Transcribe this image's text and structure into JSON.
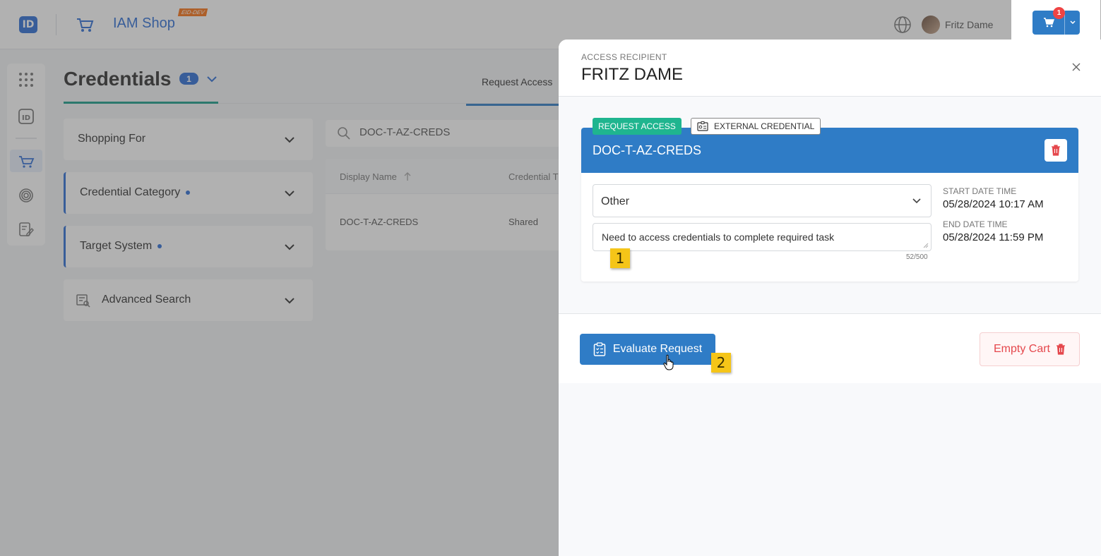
{
  "app": {
    "logo": "ID",
    "title": "IAM Shop",
    "env_badge": "EID-DEV",
    "user_name": "Fritz Dame",
    "cart_count": "1"
  },
  "page": {
    "title": "Credentials",
    "count": "1",
    "tab_request_access": "Request Access"
  },
  "filters": {
    "shopping_for": "Shopping For",
    "credential_category": "Credential Category",
    "target_system": "Target System",
    "advanced_search": "Advanced Search"
  },
  "search": {
    "value": "DOC-T-AZ-CREDS"
  },
  "grid": {
    "headers": [
      "Display Name",
      "Credential T"
    ],
    "rows": [
      {
        "display_name": "DOC-T-AZ-CREDS",
        "type": "Shared"
      }
    ]
  },
  "drawer": {
    "recipient_label": "ACCESS RECIPIENT",
    "recipient_name": "FRITZ DAME",
    "item": {
      "tag_request": "REQUEST ACCESS",
      "tag_type": "EXTERNAL CREDENTIAL",
      "name": "DOC-T-AZ-CREDS",
      "reason": "Other",
      "justification": "Need to access credentials to complete required task",
      "char_count": "52/500",
      "start_label": "START DATE TIME",
      "start_value": "05/28/2024 10:17 AM",
      "end_label": "END DATE TIME",
      "end_value": "05/28/2024 11:59 PM"
    },
    "evaluate_label": "Evaluate Request",
    "empty_cart_label": "Empty Cart"
  },
  "markers": [
    "1",
    "2"
  ],
  "colors": {
    "primary": "#2f7cc6",
    "success": "#1fb58f",
    "danger": "#e5484d",
    "marker": "#f5c518"
  }
}
